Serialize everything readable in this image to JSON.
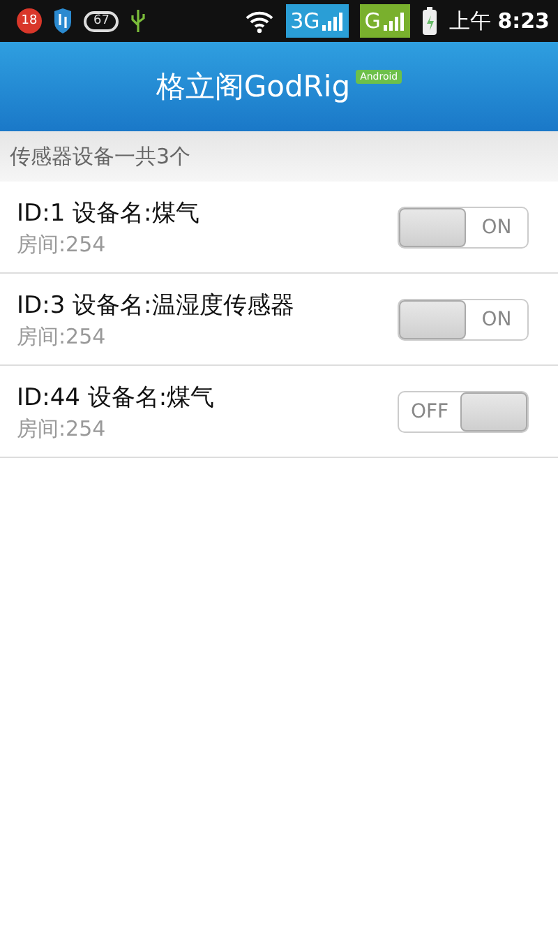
{
  "status_bar": {
    "notification_count": "18",
    "pill_icon_text": "67",
    "network_1": "3G",
    "network_2": "G",
    "time_period": "上午",
    "time": "8:23"
  },
  "header": {
    "title": "格立阁GodRig",
    "badge": "Android"
  },
  "section_header": "传感器设备一共3个",
  "devices": [
    {
      "title": "ID:1 设备名:煤气",
      "room": "房间:254",
      "on": true,
      "switch_label": "ON"
    },
    {
      "title": "ID:3 设备名:温湿度传感器",
      "room": "房间:254",
      "on": true,
      "switch_label": "ON"
    },
    {
      "title": "ID:44 设备名:煤气",
      "room": "房间:254",
      "on": false,
      "switch_label": "OFF"
    }
  ]
}
